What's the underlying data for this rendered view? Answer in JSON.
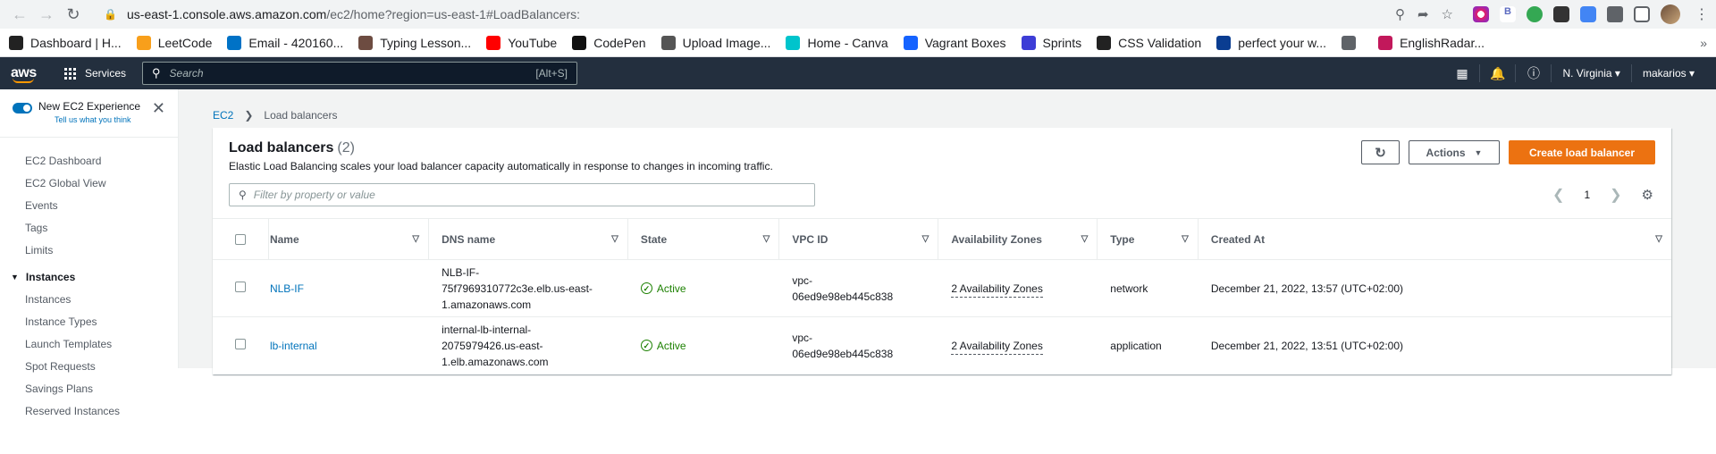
{
  "browser": {
    "url_host": "us-east-1.console.aws.amazon.com",
    "url_path": "/ec2/home?region=us-east-1#LoadBalancers:",
    "bookmarks": [
      {
        "label": "Dashboard | H...",
        "icon": "bookmark-icon-dashboard",
        "color": "#222222"
      },
      {
        "label": "LeetCode",
        "icon": "leetcode-icon",
        "color": "#f89f1b"
      },
      {
        "label": "Email - 420160...",
        "icon": "outlook-icon",
        "color": "#0072c6"
      },
      {
        "label": "Typing Lesson...",
        "icon": "typing-icon",
        "color": "#6d4c41"
      },
      {
        "label": "YouTube",
        "icon": "youtube-icon",
        "color": "#ff0000"
      },
      {
        "label": "CodePen",
        "icon": "codepen-icon",
        "color": "#111111"
      },
      {
        "label": "Upload Image...",
        "icon": "upload-icon",
        "color": "#555555"
      },
      {
        "label": "Home - Canva",
        "icon": "canva-icon",
        "color": "#00c4cc"
      },
      {
        "label": "Vagrant Boxes",
        "icon": "vagrant-icon",
        "color": "#1563ff"
      },
      {
        "label": "Sprints",
        "icon": "sprints-icon",
        "color": "#3d3dd6"
      },
      {
        "label": "CSS Validation",
        "icon": "w3c-icon",
        "color": "#222222"
      },
      {
        "label": "perfect your w...",
        "icon": "grammar-icon",
        "color": "#0a3d91"
      },
      {
        "label": "",
        "icon": "globe-icon",
        "color": "#5f6368"
      },
      {
        "label": "EnglishRadar...",
        "icon": "englishradar-icon",
        "color": "#c2185b"
      }
    ]
  },
  "aws": {
    "services_label": "Services",
    "search_placeholder": "Search",
    "search_shortcut": "[Alt+S]",
    "region": "N. Virginia",
    "user": "makarios"
  },
  "sidebar": {
    "toggle_label": "New EC2 Experience",
    "toggle_sub": "Tell us what you think",
    "items": [
      "EC2 Dashboard",
      "EC2 Global View",
      "Events",
      "Tags",
      "Limits"
    ],
    "instances_section": "Instances",
    "instance_items": [
      "Instances",
      "Instance Types",
      "Launch Templates",
      "Spot Requests",
      "Savings Plans",
      "Reserved Instances"
    ]
  },
  "breadcrumb": {
    "root": "EC2",
    "current": "Load balancers"
  },
  "panel": {
    "title": "Load balancers",
    "count": "(2)",
    "description": "Elastic Load Balancing scales your load balancer capacity automatically in response to changes in incoming traffic.",
    "actions_label": "Actions",
    "create_label": "Create load balancer",
    "filter_placeholder": "Filter by property or value",
    "page": "1"
  },
  "table": {
    "columns": [
      "Name",
      "DNS name",
      "State",
      "VPC ID",
      "Availability Zones",
      "Type",
      "Created At"
    ],
    "rows": [
      {
        "name": "NLB-IF",
        "dns": [
          "NLB-IF-",
          "75f7969310772c3e.elb.us-east-",
          "1.amazonaws.com"
        ],
        "state": "Active",
        "vpc": [
          "vpc-",
          "06ed9e98eb445c838"
        ],
        "az": "2 Availability Zones",
        "type": "network",
        "created": "December 21, 2022, 13:57 (UTC+02:00)"
      },
      {
        "name": "lb-internal",
        "dns": [
          "internal-lb-internal-",
          "2075979426.us-east-",
          "1.elb.amazonaws.com"
        ],
        "state": "Active",
        "vpc": [
          "vpc-",
          "06ed9e98eb445c838"
        ],
        "az": "2 Availability Zones",
        "type": "application",
        "created": "December 21, 2022, 13:51 (UTC+02:00)"
      }
    ]
  }
}
